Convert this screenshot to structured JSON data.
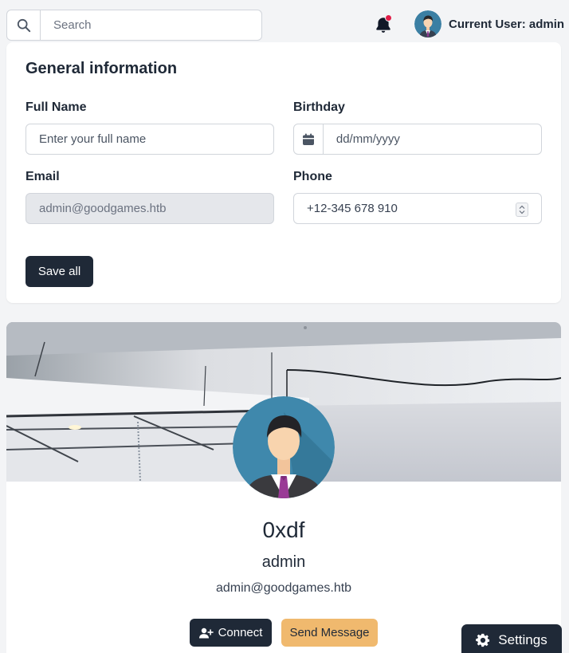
{
  "topbar": {
    "search_placeholder": "Search",
    "current_user_label": "Current User: admin"
  },
  "general": {
    "title": "General information",
    "full_name_label": "Full Name",
    "full_name_placeholder": "Enter your full name",
    "birthday_label": "Birthday",
    "birthday_placeholder": "dd/mm/yyyy",
    "email_label": "Email",
    "email_value": "admin@goodgames.htb",
    "phone_label": "Phone",
    "phone_value": "+12-345 678 910",
    "save_label": "Save all"
  },
  "profile": {
    "name": "0xdf",
    "role": "admin",
    "email": "admin@goodgames.htb",
    "connect_label": "Connect",
    "message_label": "Send Message"
  },
  "settings_label": "Settings",
  "colors": {
    "dark": "#1f2937",
    "accent": "#f0b96e",
    "notification": "#e11d48",
    "background": "#f3f4f6"
  },
  "icons": {
    "search": "search-icon",
    "bell": "bell-icon",
    "calendar": "calendar-icon",
    "connect": "user-plus-icon",
    "settings": "gear-icon"
  }
}
